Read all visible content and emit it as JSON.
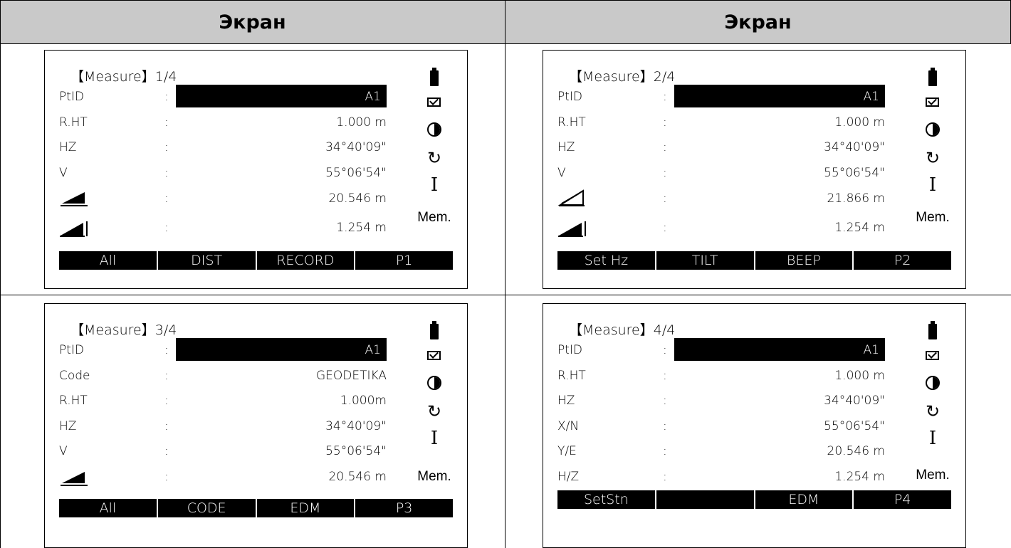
{
  "table": {
    "headers": [
      "Экран",
      "Экран"
    ]
  },
  "screens": [
    {
      "title": "【Measure】1/4",
      "rows": [
        {
          "label": "PtID",
          "colon": ":",
          "value": "A1",
          "highlight": true
        },
        {
          "label": "R.HT",
          "colon": ":",
          "value": "1.000 m"
        },
        {
          "label": "HZ",
          "colon": ":",
          "value": "34°40'09\""
        },
        {
          "label": "V",
          "colon": ":",
          "value": "55°06'54\""
        },
        {
          "icon": "horizontal-distance-icon",
          "colon": ":",
          "value": "20.546 m"
        },
        {
          "icon": "height-difference-icon",
          "colon": ":",
          "value": "1.254 m"
        }
      ],
      "softkeys": [
        "All",
        "DIST",
        "RECORD",
        "P1"
      ]
    },
    {
      "title": "【Measure】2/4",
      "rows": [
        {
          "label": "PtID",
          "colon": ":",
          "value": "A1",
          "highlight": true
        },
        {
          "label": "R.HT",
          "colon": ":",
          "value": "1.000 m"
        },
        {
          "label": "HZ",
          "colon": ":",
          "value": "34°40'09\""
        },
        {
          "label": "V",
          "colon": ":",
          "value": "55°06'54\""
        },
        {
          "icon": "slope-distance-icon",
          "colon": ":",
          "value": "21.866 m"
        },
        {
          "icon": "height-difference-icon",
          "colon": ":",
          "value": "1.254 m"
        }
      ],
      "softkeys": [
        "Set Hz",
        "TILT",
        "BEEP",
        "P2"
      ]
    },
    {
      "title": "【Measure】3/4",
      "rows": [
        {
          "label": "PtID",
          "colon": ":",
          "value": "A1",
          "highlight": true
        },
        {
          "label": "Code",
          "colon": ":",
          "value": "GEODETIKA"
        },
        {
          "label": "R.HT",
          "colon": ":",
          "value": "1.000m"
        },
        {
          "label": "HZ",
          "colon": ":",
          "value": "34°40'09\""
        },
        {
          "label": "V",
          "colon": ":",
          "value": "55°06'54\""
        },
        {
          "icon": "horizontal-distance-icon",
          "colon": ":",
          "value": "20.546 m"
        }
      ],
      "softkeys": [
        "All",
        "CODE",
        "EDM",
        "P3"
      ]
    },
    {
      "title": "【Measure】4/4",
      "rows": [
        {
          "label": "PtID",
          "colon": ":",
          "value": "A1",
          "highlight": true
        },
        {
          "label": "R.HT",
          "colon": ":",
          "value": "1.000 m"
        },
        {
          "label": "HZ",
          "colon": ":",
          "value": "34°40'09\""
        },
        {
          "label": "X/N",
          "colon": ":",
          "value": "55°06'54\""
        },
        {
          "label": "Y/E",
          "colon": ":",
          "value": "20.546 m"
        },
        {
          "label": "H/Z",
          "colon": ":",
          "value": "1.254 m"
        }
      ],
      "softkeys": [
        "SetStn",
        "",
        "EDM",
        "P4"
      ]
    }
  ],
  "status_icons": [
    "battery-icon",
    "mail-icon",
    "contrast-icon",
    "refresh-icon",
    "ibeam-icon"
  ],
  "mem_label": "Mem."
}
